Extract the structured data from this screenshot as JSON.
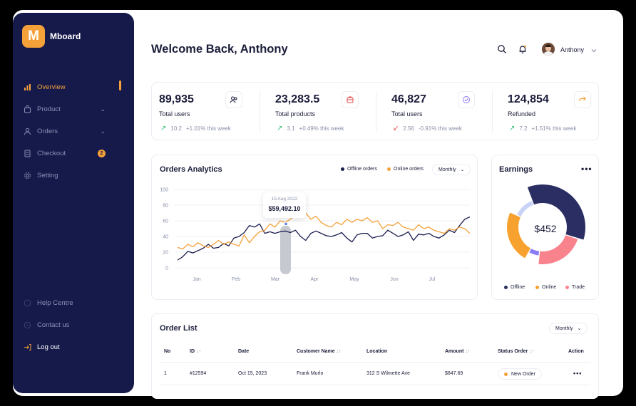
{
  "sidebar": {
    "brand": "Mboard",
    "logo_letter": "M",
    "items": [
      {
        "label": "Overview",
        "icon": "bar-chart-icon"
      },
      {
        "label": "Product",
        "icon": "bag-icon"
      },
      {
        "label": "Orders",
        "icon": "user-icon"
      },
      {
        "label": "Checkout",
        "icon": "file-icon",
        "badge": "2"
      },
      {
        "label": "Setting",
        "icon": "gear-icon"
      }
    ],
    "bottom": [
      {
        "label": "Help Centre",
        "icon": "help-icon"
      },
      {
        "label": "Contact us",
        "icon": "chat-icon"
      },
      {
        "label": "Log out",
        "icon": "logout-icon"
      }
    ]
  },
  "header": {
    "title": "Welcome Back, Anthony",
    "user_name": "Anthony"
  },
  "stats": [
    {
      "value": "89,935",
      "label": "Total users",
      "delta": "10.2",
      "pct": "+1.01% this week",
      "dir": "up",
      "icon": "users-icon"
    },
    {
      "value": "23,283.5",
      "label": "Total products",
      "delta": "3.1",
      "pct": "+0.49% this week",
      "dir": "up",
      "icon": "box-icon"
    },
    {
      "value": "46,827",
      "label": "Total users",
      "delta": "2.56",
      "pct": "-0.91% this week",
      "dir": "down",
      "icon": "check-circle-icon"
    },
    {
      "value": "124,854",
      "label": "Refunded",
      "delta": "7.2",
      "pct": "+1.51% this week",
      "dir": "up",
      "icon": "refund-arrow-icon"
    }
  ],
  "analytics": {
    "title": "Orders Analytics",
    "legend_offline": "Offline orders",
    "legend_online": "Online orders",
    "period": "Monthly",
    "tooltip_date": "15 Aug 2022",
    "tooltip_value": "$59,492.10"
  },
  "chart_data": {
    "type": "line",
    "x": [
      "Jan",
      "Feb",
      "Mar",
      "Apr",
      "May",
      "Jun",
      "Jul"
    ],
    "yticks": [
      0,
      20,
      40,
      60,
      80,
      100
    ],
    "ylim": [
      0,
      100
    ],
    "series": [
      {
        "name": "Offline orders",
        "color": "#1b1d4e",
        "values": [
          10,
          14,
          21,
          19,
          22,
          25,
          30,
          25,
          26,
          31,
          28,
          38,
          40,
          45,
          54,
          52,
          56,
          44,
          46,
          44,
          46,
          47,
          45,
          48,
          40,
          35,
          44,
          47,
          44,
          41,
          40,
          42,
          45,
          38,
          33,
          42,
          44,
          44,
          38,
          40,
          41,
          48,
          44,
          40,
          42,
          46,
          35,
          43,
          42,
          44,
          40,
          38,
          42,
          48,
          45,
          54,
          62,
          65
        ]
      },
      {
        "name": "Online orders",
        "color": "#f5a13a",
        "values": [
          26,
          24,
          30,
          27,
          32,
          28,
          26,
          30,
          35,
          30,
          33,
          30,
          28,
          42,
          32,
          40,
          46,
          48,
          56,
          52,
          60,
          58,
          62,
          68,
          66,
          70,
          62,
          66,
          58,
          54,
          52,
          58,
          55,
          62,
          58,
          62,
          60,
          64,
          58,
          60,
          50,
          55,
          54,
          58,
          52,
          50,
          48,
          55,
          50,
          52,
          48,
          46,
          44,
          50,
          48,
          52,
          50,
          44
        ]
      }
    ]
  },
  "earnings": {
    "title": "Earnings",
    "center": "$452",
    "legend": [
      "Offline",
      "Online",
      "Trade"
    ],
    "segments": [
      {
        "name": "Offline",
        "value": 36,
        "color": "#2a2e62"
      },
      {
        "name": "Trade",
        "value": 22,
        "color": "#f8838d"
      },
      {
        "name": "Purple",
        "value": 6,
        "color": "#8b7cf6"
      },
      {
        "name": "Online",
        "value": 24,
        "color": "#f7a22e"
      },
      {
        "name": "Light",
        "value": 12,
        "color": "#c9d3f7"
      }
    ]
  },
  "orders": {
    "title": "Order List",
    "period": "Monthly",
    "columns": [
      "No",
      "ID",
      "Date",
      "Customer Name",
      "Location",
      "Amount",
      "Status Order",
      "Action"
    ],
    "rows": [
      {
        "no": "1",
        "id": "#12594",
        "date": "Oct 15, 2023",
        "customer": "Frank Murlo",
        "location": "312 S Wilmette Ave",
        "amount": "$847.69",
        "status": "New Order"
      }
    ]
  },
  "colors": {
    "sidebar": "#151a4a",
    "accent": "#f5a13a",
    "up": "#2fbf71",
    "down": "#e24a4a"
  }
}
